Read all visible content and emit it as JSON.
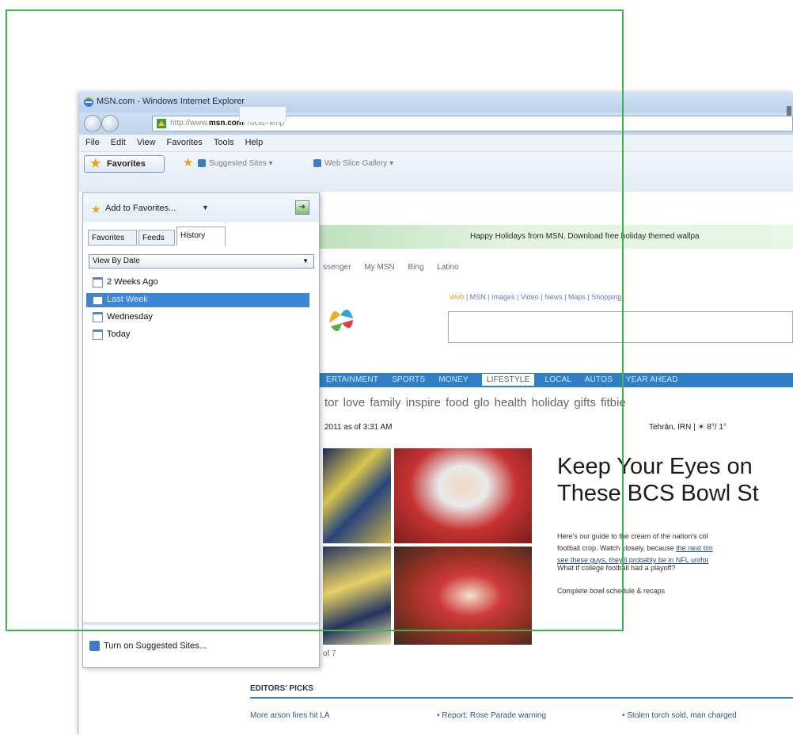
{
  "window": {
    "title": "MSN.com - Windows Internet Explorer",
    "address_prefix": "http://www.",
    "address_domain": "msn.com",
    "address_suffix": "/?ocid=iehp"
  },
  "menu": [
    "File",
    "Edit",
    "View",
    "Favorites",
    "Tools",
    "Help"
  ],
  "favorites_bar": {
    "favorites_button": "Favorites",
    "suggested_sites": "Suggested Sites ▾",
    "web_slice_gallery": "Web Slice Gallery ▾"
  },
  "favorites_panel": {
    "add_to_favorites": "Add to Favorites...",
    "add_dropdown": "▼",
    "tabs": [
      "Favorites",
      "Feeds",
      "History"
    ],
    "view_select": "View By Date",
    "history_items": [
      "2 Weeks Ago",
      "Last Week",
      "Wednesday",
      "Today"
    ],
    "selected_index": 1,
    "turn_on_suggested": "Turn on Suggested Sites..."
  },
  "msn": {
    "banner": "Happy Holidays from MSN. Download free holiday themed wallpa",
    "topnav": [
      "ssenger",
      "My MSN",
      "Bing",
      "Latino"
    ],
    "search_tabs": "Web  |  MSN  |  Images  |  Video  |  News  |  Maps  |  Shopping",
    "search_tab_web": "Web",
    "search_tab_rest": "  |  MSN  |  Images  |  Video  |  News  |  Maps  |  Shopping",
    "channels": [
      "ERTAINMENT",
      "SPORTS",
      "MONEY",
      "LIFESTYLE",
      "LOCAL",
      "AUTOS",
      "YEAR AHEAD"
    ],
    "subnav": "tor  love  family  inspire  food  glo  health  holiday gifts  fitbie",
    "date": "2011 as of 3:31 AM",
    "weather": "Tehrān, IRN | ☀ 8°/ 1°",
    "headline": "Keep Your Eyes on\nThese BCS Bowl St",
    "story_line1": "Here's our guide to the cream of the nation's col",
    "story_line2_text": "football crop. Watch closely, because ",
    "story_line2_link": "the next tim",
    "story_line3_link": "see these guys, they'll probably be in NFL unifor",
    "playoff_link": "What if college football had a playoff?",
    "bowl_link": "Complete bowl schedule & recaps",
    "page_counter": "of 7",
    "editors_picks": "EDITORS' PICKS",
    "picks": [
      "More arson fires hit LA",
      "• Report: Rose Parade warning",
      "• Stolen torch sold, man charged"
    ]
  }
}
